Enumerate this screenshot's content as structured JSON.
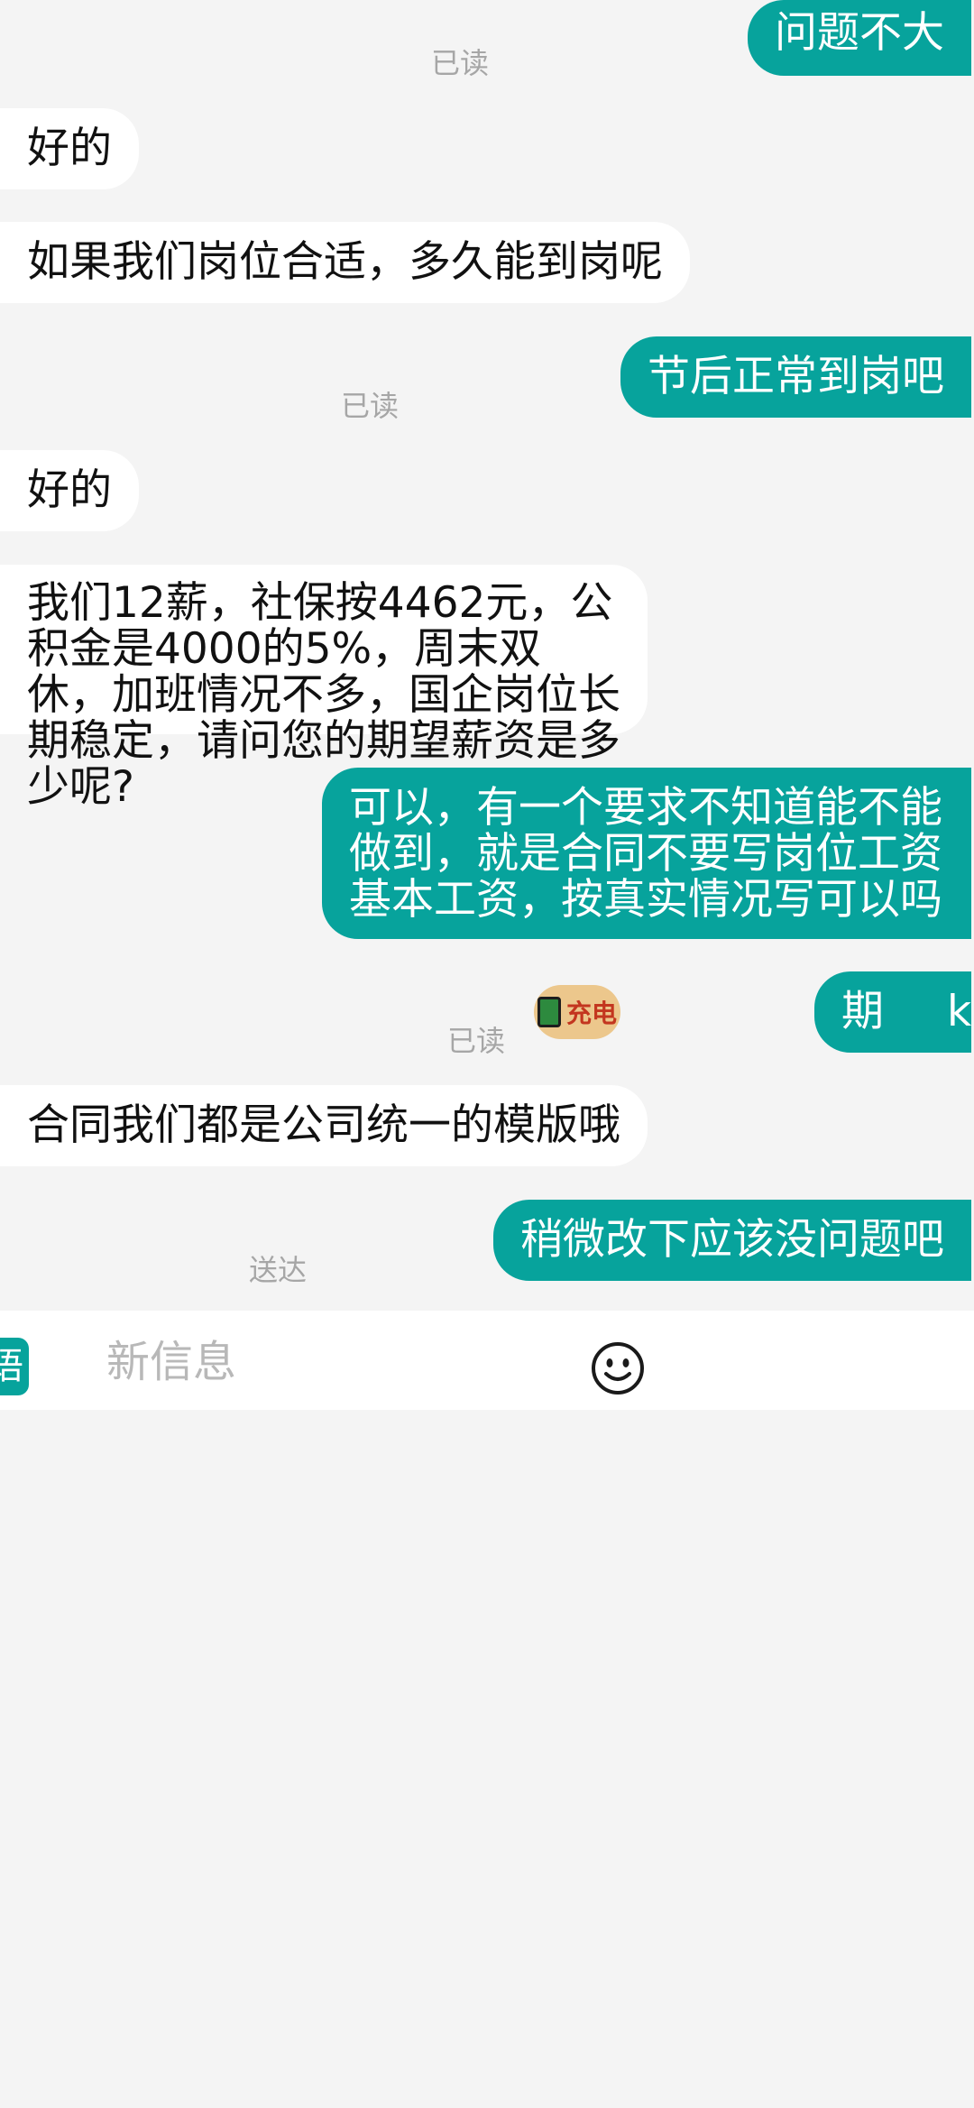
{
  "messages": [
    {
      "dir": "out",
      "text": "问题不大",
      "receipt": "已读"
    },
    {
      "dir": "in",
      "text": "好的"
    },
    {
      "dir": "in",
      "text": "如果我们岗位合适，多久能到岗呢"
    },
    {
      "dir": "out",
      "text": "节后正常到岗吧",
      "receipt": "已读"
    },
    {
      "dir": "in",
      "text": "好的"
    },
    {
      "dir": "in",
      "text": "我们12薪，社保按4462元，公积金是4000的5%，周末双休，加班情况不多，国企岗位长期稳定，请问您的期望薪资是多少呢?"
    },
    {
      "dir": "out",
      "text": "可以，有一个要求不知道能不能做到，就是合同不要写岗位工资基本工资，按真实情况写可以吗"
    },
    {
      "dir": "out",
      "text_start": "期",
      "text_end": "k",
      "receipt": "已读",
      "sticker_text": "充电"
    },
    {
      "dir": "in",
      "text": "合同我们都是公司统一的模版哦"
    },
    {
      "dir": "out",
      "text": "稍微改下应该没问题吧",
      "receipt": "送达"
    }
  ],
  "composer": {
    "lang_label": "语",
    "placeholder": "新信息",
    "emoji_icon": "smiley-face-icon"
  },
  "colors": {
    "accent": "#07a39c",
    "background": "#f4f4f4",
    "incoming_bubble": "#ffffff",
    "receipt_text": "#a6a6a6"
  }
}
